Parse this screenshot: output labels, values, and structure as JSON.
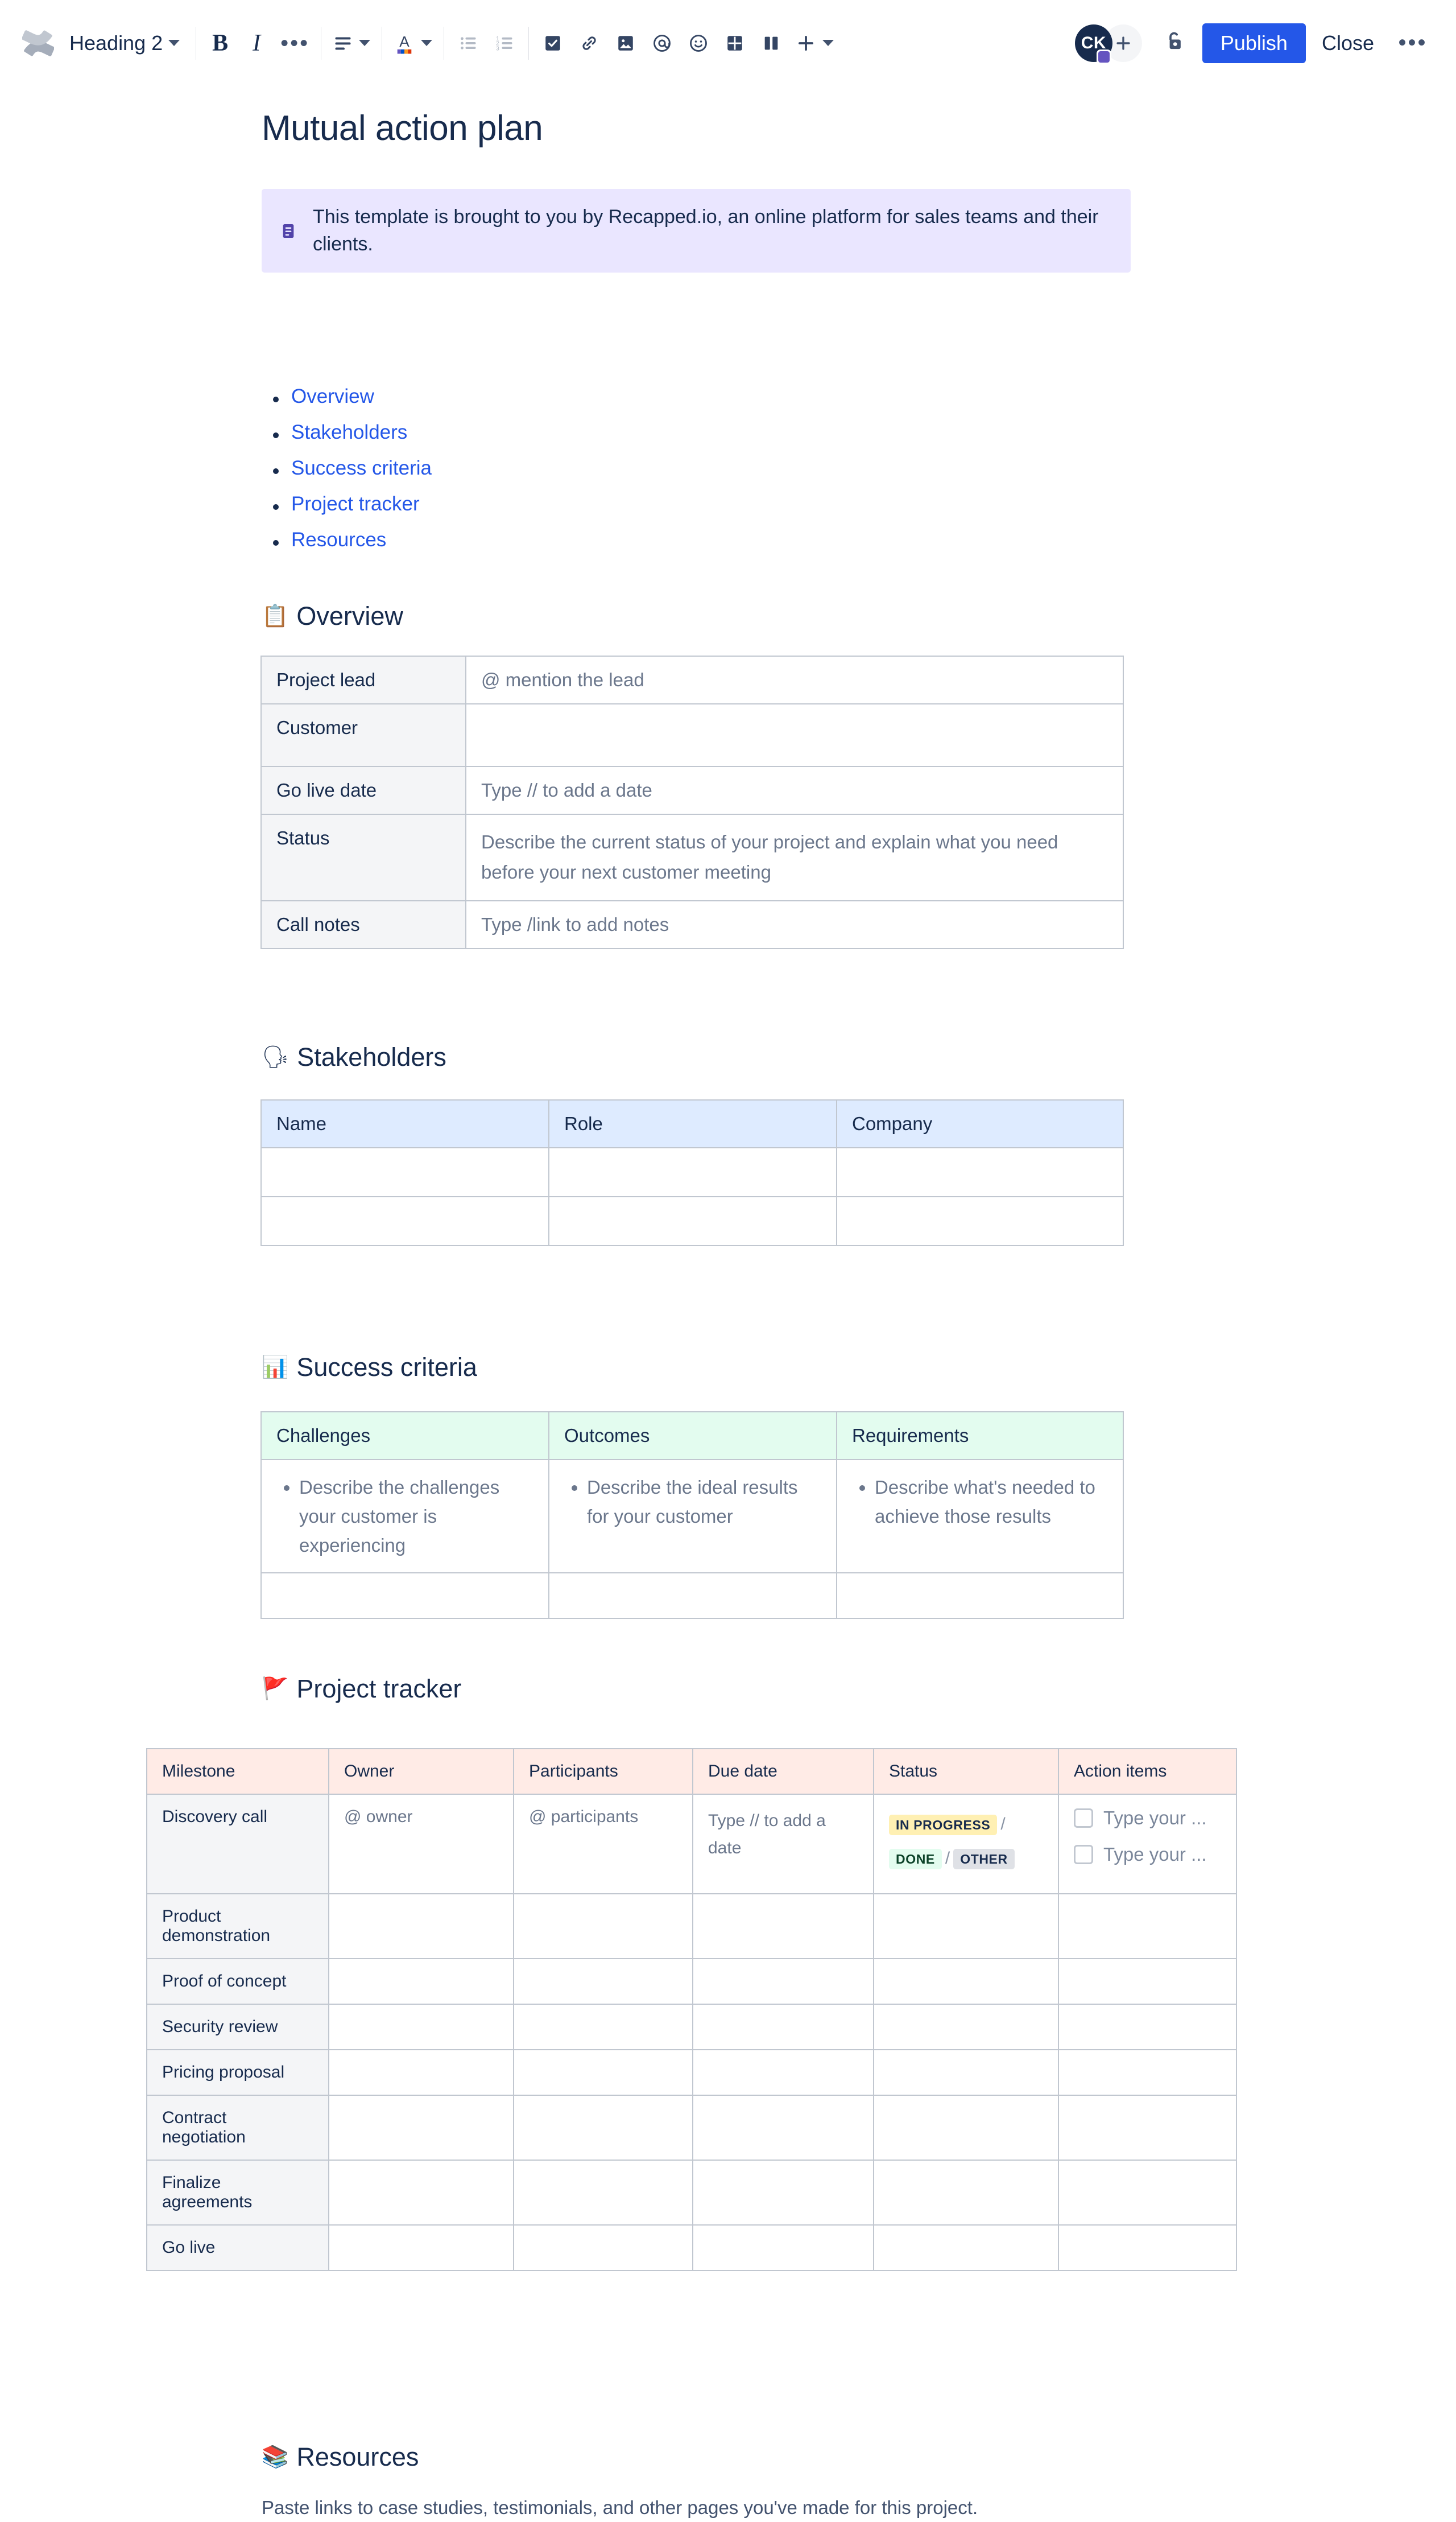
{
  "toolbar": {
    "logo_name": "confluence-logo",
    "style_select": "Heading 2",
    "buttons": [
      {
        "name": "bold",
        "label": "B"
      },
      {
        "name": "italic",
        "label": "I"
      },
      {
        "name": "more-formatting",
        "label": "•••"
      },
      {
        "name": "text-align",
        "label": ""
      },
      {
        "name": "text-color",
        "label": "A"
      },
      {
        "name": "bullet-list",
        "label": ""
      },
      {
        "name": "numbered-list",
        "label": ""
      },
      {
        "name": "task-list",
        "label": ""
      },
      {
        "name": "link",
        "label": ""
      },
      {
        "name": "image",
        "label": ""
      },
      {
        "name": "mention",
        "label": "@"
      },
      {
        "name": "emoji",
        "label": ""
      },
      {
        "name": "table",
        "label": ""
      },
      {
        "name": "layout",
        "label": ""
      },
      {
        "name": "insert-more",
        "label": "+"
      }
    ],
    "avatar_initials": "CK",
    "add_people_label": "+",
    "restrictions_label": "lock-icon",
    "publish_label": "Publish",
    "close_label": "Close",
    "more_label": "•••"
  },
  "doc": {
    "title": "Mutual action plan",
    "banner": {
      "icon": "info-note-icon",
      "text": "This template is brought to you by Recapped.io, an online platform for sales teams and their clients."
    },
    "toc": [
      {
        "label": "Overview"
      },
      {
        "label": "Stakeholders"
      },
      {
        "label": "Success criteria"
      },
      {
        "label": "Project tracker"
      },
      {
        "label": "Resources"
      }
    ]
  },
  "overview": {
    "emoji": "📋",
    "heading": "Overview",
    "rows": [
      {
        "label": "Project lead",
        "value": "@ mention the lead"
      },
      {
        "label": "Customer",
        "value": ""
      },
      {
        "label": "Go live date",
        "value": "Type // to add a date"
      },
      {
        "label": "Status",
        "value": "Describe the current status of your project and explain what you need before your next customer meeting"
      },
      {
        "label": "Call notes",
        "value": "Type /link to add notes"
      }
    ]
  },
  "stakeholders": {
    "emoji": "🗣",
    "heading": "Stakeholders",
    "headers": [
      "Name",
      "Role",
      "Company"
    ],
    "rows": [
      [
        "",
        "",
        ""
      ],
      [
        "",
        "",
        ""
      ]
    ]
  },
  "success_criteria": {
    "emoji": "📊",
    "heading": "Success criteria",
    "headers": [
      "Challenges",
      "Outcomes",
      "Requirements"
    ],
    "rows": [
      [
        "Describe the challenges your customer is experiencing",
        "Describe the ideal results for your customer",
        "Describe what's needed to achieve those results"
      ],
      [
        "",
        "",
        ""
      ]
    ]
  },
  "project_tracker": {
    "emoji": "🚩",
    "heading": "Project tracker",
    "headers": [
      "Milestone",
      "Owner",
      "Participants",
      "Due date",
      "Status",
      "Action items"
    ],
    "first_row": {
      "milestone": "Discovery call",
      "owner": "@ owner",
      "participants": "@ participants",
      "due_date": "Type // to add a date",
      "status_options": [
        "IN PROGRESS",
        "DONE",
        "OTHER"
      ],
      "status_separator": "/",
      "action_items": [
        "Type your ...",
        "Type your ..."
      ]
    },
    "milestones": [
      "Product demonstration",
      "Proof of concept",
      "Security review",
      "Pricing proposal",
      "Contract negotiation",
      "Finalize agreements",
      "Go live"
    ]
  },
  "resources": {
    "emoji": "📚",
    "heading": "Resources",
    "body": "Paste links to case studies, testimonials, and other pages you've made for this project."
  },
  "colors": {
    "accent": "#2457E8",
    "banner_bg": "#EAE6FF",
    "header_blue": "#DEEBFF",
    "header_green": "#E3FCEF",
    "header_red": "#FFEBE6",
    "row_grey": "#F4F5F7",
    "border": "#C1C7D0",
    "text": "#172B4D",
    "placeholder": "#6B778C"
  }
}
